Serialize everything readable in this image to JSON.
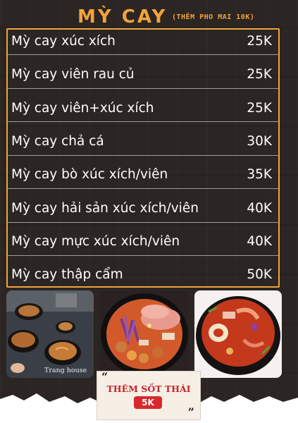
{
  "header": {
    "title": "MỲ CAY",
    "subtitle": "(THÊM PHO MAI 10K)"
  },
  "menu": {
    "items": [
      {
        "name": "Mỳ cay xúc xích",
        "price": "25K"
      },
      {
        "name": "Mỳ cay viên rau củ",
        "price": "25K"
      },
      {
        "name": "Mỳ cay viên+xúc xích",
        "price": "25K"
      },
      {
        "name": "Mỳ cay chả cá",
        "price": "30K"
      },
      {
        "name": "Mỳ cay bò xúc xích/viên",
        "price": "35K"
      },
      {
        "name": "Mỳ cay hải sản xúc xích/viên",
        "price": "40K"
      },
      {
        "name": "Mỳ cay mực xúc xích/viên",
        "price": "40K"
      },
      {
        "name": "Mỳ cay thập cẩm",
        "price": "50K"
      }
    ]
  },
  "photos": {
    "watermark": "Trang house"
  },
  "badge": {
    "open_quote": "“",
    "label": "THÊM SỐT THÁI",
    "price": "5K",
    "close_quote": "”"
  },
  "colors": {
    "accent": "#f2a33a",
    "background": "#2b2523",
    "badge_red": "#d8282f"
  }
}
